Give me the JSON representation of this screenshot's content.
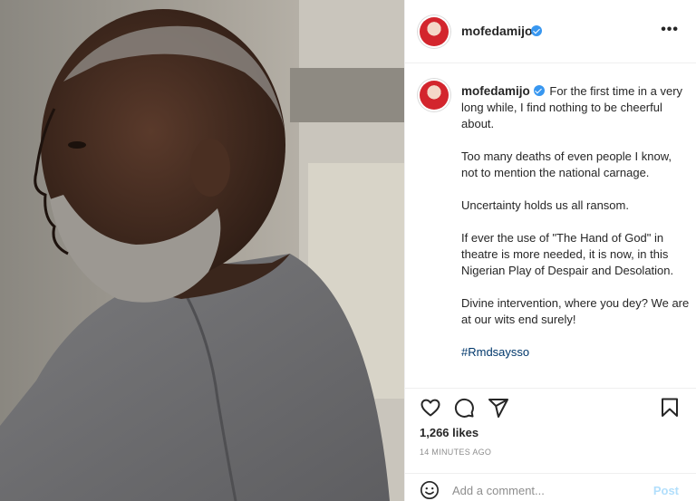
{
  "post": {
    "username": "mofedamijo",
    "verified": true,
    "caption": {
      "username": "mofedamijo",
      "lines": [
        "For the first time in a very long while, I find nothing to be cheerful about.",
        "Too many deaths of even people I know, not to mention the national carnage.",
        "Uncertainty holds us all ransom.",
        "If ever the use of \"The Hand of God\" in theatre is more needed, it is now, in this Nigerian Play of Despair and Desolation.",
        "Divine intervention, where you dey? We are at our wits end surely!"
      ],
      "hashtag": "#Rmdsaysso"
    },
    "likes": "1,266 likes",
    "timestamp": "14 MINUTES AGO",
    "comment_box": {
      "placeholder": "Add a comment...",
      "post_label": "Post"
    },
    "header_menu_label": "•••"
  },
  "colors": {
    "verified_badge": "#3897f0",
    "hashtag_link": "#00376b",
    "post_button_disabled": "#b2dffc",
    "secondary_text": "#8e8e8e"
  },
  "icons": [
    "more-options-icon",
    "heart-icon",
    "comment-icon",
    "share-icon",
    "bookmark-icon",
    "emoji-icon",
    "verified-badge-icon"
  ]
}
